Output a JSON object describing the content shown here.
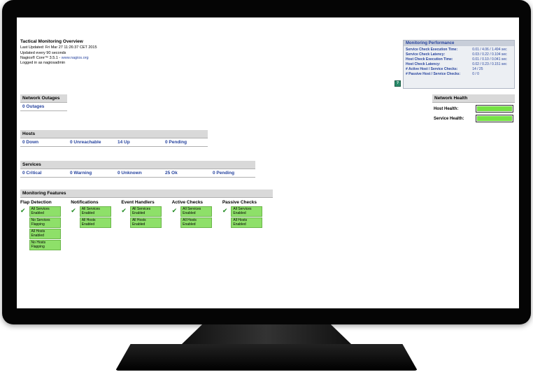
{
  "header": {
    "title": "Tactical Monitoring Overview",
    "last_updated": "Last Updated: Fri Mar 27 11:26:37 CET 2015",
    "update_interval": "Updated every 90 seconds",
    "version_text": "Nagios® Core™ 3.5.1 - ",
    "link_text": "www.nagios.org",
    "user_info": "Logged in as nagiosadmin"
  },
  "performance": {
    "title": "Monitoring Performance",
    "rows": [
      {
        "label": "Service Check Execution Time:",
        "value": "0.01 / 4.06 / 1.494 sec"
      },
      {
        "label": "Service Check Latency:",
        "value": "0.03 / 0.22 / 0.104 sec"
      },
      {
        "label": "Host Check Execution Time:",
        "value": "0.01 / 0.10 / 0.041 sec"
      },
      {
        "label": "Host Check Latency:",
        "value": "0.02 / 0.23 / 0.151 sec"
      },
      {
        "label": "# Active Host / Service Checks:",
        "value": "14 / 25"
      },
      {
        "label": "# Passive Host / Service Checks:",
        "value": "0 / 0"
      }
    ]
  },
  "outages": {
    "title": "Network Outages",
    "value": "0 Outages"
  },
  "health": {
    "title": "Network Health",
    "host_label": "Host Health:",
    "service_label": "Service Health:"
  },
  "hosts": {
    "title": "Hosts",
    "down": "0 Down",
    "unreachable": "0 Unreachable",
    "up": "14 Up",
    "pending": "0 Pending"
  },
  "services": {
    "title": "Services",
    "critical": "0 Critical",
    "warning": "0 Warning",
    "unknown": "0 Unknown",
    "ok": "25 Ok",
    "pending": "0 Pending"
  },
  "features": {
    "title": "Monitoring Features",
    "columns": [
      {
        "name": "Flap Detection",
        "items": [
          "All Services Enabled",
          "No Services Flapping",
          "All Hosts Enabled",
          "No Hosts Flapping"
        ]
      },
      {
        "name": "Notifications",
        "items": [
          "All Services Enabled",
          "All Hosts Enabled"
        ]
      },
      {
        "name": "Event Handlers",
        "items": [
          "All Services Enabled",
          "All Hosts Enabled"
        ]
      },
      {
        "name": "Active Checks",
        "items": [
          "All Services Enabled",
          "All Hosts Enabled"
        ]
      },
      {
        "name": "Passive Checks",
        "items": [
          "All Services Enabled",
          "All Hosts Enabled"
        ]
      }
    ]
  }
}
